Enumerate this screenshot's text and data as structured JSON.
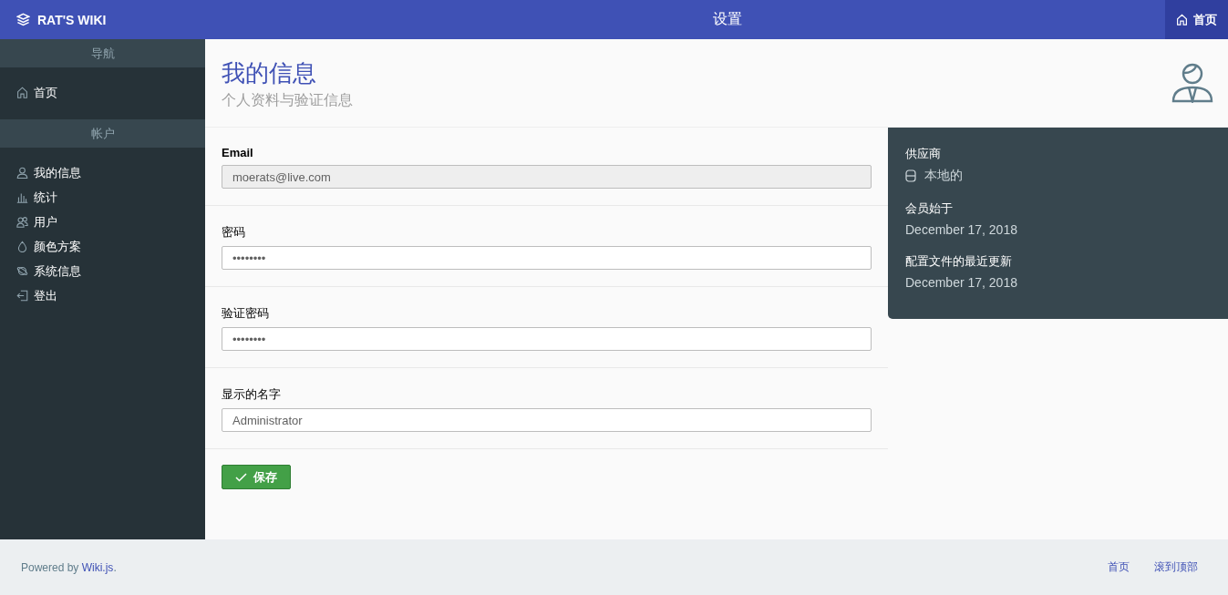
{
  "header": {
    "brand": "RAT'S WIKI",
    "title": "设置",
    "home_button": "首页"
  },
  "sidebar": {
    "sections": [
      {
        "heading": "导航",
        "items": [
          {
            "label": "首页",
            "kind": "home"
          }
        ]
      },
      {
        "heading": "帐户",
        "items": [
          {
            "label": "我的信息",
            "kind": "user"
          },
          {
            "label": "统计",
            "kind": "chart"
          },
          {
            "label": "用户",
            "kind": "users"
          },
          {
            "label": "颜色方案",
            "kind": "drop"
          },
          {
            "label": "系统信息",
            "kind": "system"
          },
          {
            "label": "登出",
            "kind": "logout"
          }
        ]
      }
    ]
  },
  "page": {
    "title": "我的信息",
    "subtitle": "个人资料与验证信息"
  },
  "form": {
    "fields": [
      {
        "label": "Email",
        "value": "moerats@live.com",
        "disabled": true
      },
      {
        "label": "密码",
        "value": "••••••••",
        "disabled": false
      },
      {
        "label": "验证密码",
        "value": "••••••••",
        "disabled": false
      },
      {
        "label": "显示的名字",
        "value": "Administrator",
        "disabled": false
      }
    ],
    "save_button": "保存"
  },
  "info_panel": {
    "provider_label": "供应商",
    "provider_value": "本地的",
    "member_since_label": "会员始于",
    "member_since_value": "December 17, 2018",
    "last_update_label": "配置文件的最近更新",
    "last_update_value": "December 17, 2018"
  },
  "footer": {
    "powered_prefix": "Powered by",
    "powered_link": "Wiki.js",
    "powered_suffix": ".",
    "links": [
      "首页",
      "滚到顶部"
    ]
  }
}
